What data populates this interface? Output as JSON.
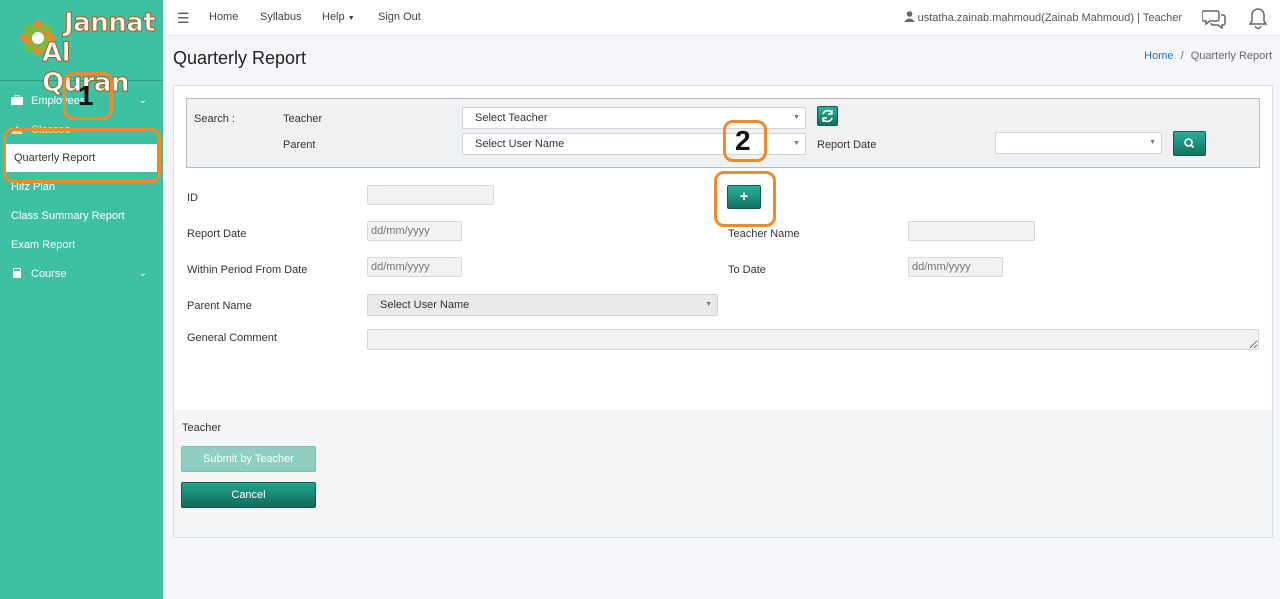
{
  "brand": {
    "line1": "Jannat",
    "line2": "Al Quran"
  },
  "sidebar": {
    "items": [
      {
        "label": "Employees",
        "icon": "briefcase-icon"
      },
      {
        "label": "Classes",
        "icon": "classes-icon"
      },
      {
        "label": "Quarterly Report"
      },
      {
        "label": "Hifz Plan"
      },
      {
        "label": "Class Summary Report"
      },
      {
        "label": "Exam Report"
      },
      {
        "label": "Course",
        "icon": "book-icon"
      }
    ]
  },
  "topbar": {
    "nav": [
      "Home",
      "Syllabus",
      "Help",
      "Sign Out"
    ],
    "user": "ustatha.zainab.mahmoud(Zainab Mahmoud) | Teacher"
  },
  "page": {
    "title": "Quarterly Report",
    "breadcrumb": {
      "home": "Home",
      "sep": "/",
      "current": "Quarterly Report"
    }
  },
  "search": {
    "label": "Search :",
    "teacher_label": "Teacher",
    "teacher_value": "Select Teacher",
    "parent_label": "Parent",
    "parent_value": "Select User Name",
    "report_date_label": "Report Date",
    "report_date_value": ""
  },
  "form": {
    "id_label": "ID",
    "id_value": "",
    "report_date_label": "Report Date",
    "report_date_placeholder": "dd/mm/yyyy",
    "teacher_name_label": "Teacher Name",
    "teacher_name_value": "",
    "from_label": "Within Period From Date",
    "from_placeholder": "dd/mm/yyyy",
    "to_label": "To Date",
    "to_placeholder": "dd/mm/yyyy",
    "parent_name_label": "Parent Name",
    "parent_name_value": "Select User Name",
    "comment_label": "General Comment",
    "comment_value": ""
  },
  "footer": {
    "section_label": "Teacher",
    "submit_label": "Submit by Teacher",
    "cancel_label": "Cancel"
  },
  "annotations": {
    "one": "1",
    "two": "2"
  },
  "colors": {
    "sidebar": "#3ec0a3",
    "button": "#1a8c77",
    "annotation": "#f08a2b"
  }
}
